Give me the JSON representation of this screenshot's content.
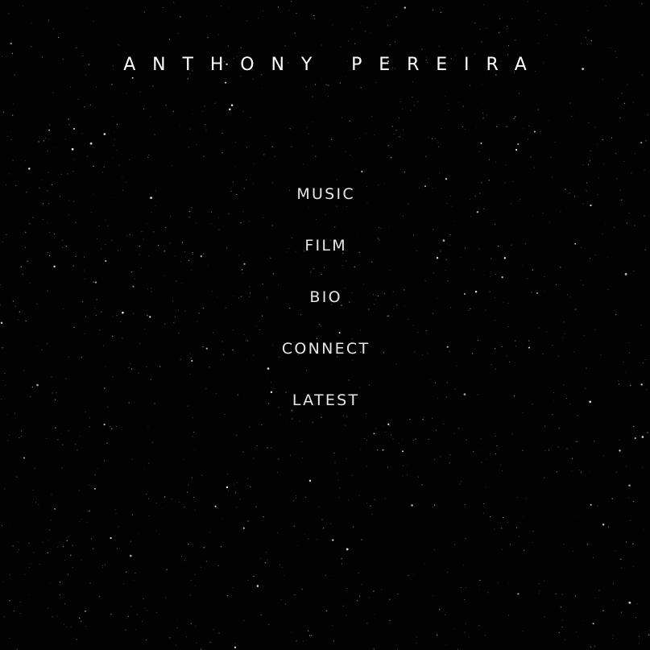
{
  "site": {
    "title": "ANTHONY PEREIRA"
  },
  "nav": {
    "items": [
      {
        "label": "MUSIC"
      },
      {
        "label": "FILM"
      },
      {
        "label": "BIO"
      },
      {
        "label": "CONNECT"
      },
      {
        "label": "LATEST"
      }
    ]
  },
  "colors": {
    "background": "#020202",
    "title_text": "#ffffff",
    "nav_text": "#e8e8e8",
    "stars": "#ffffff"
  }
}
